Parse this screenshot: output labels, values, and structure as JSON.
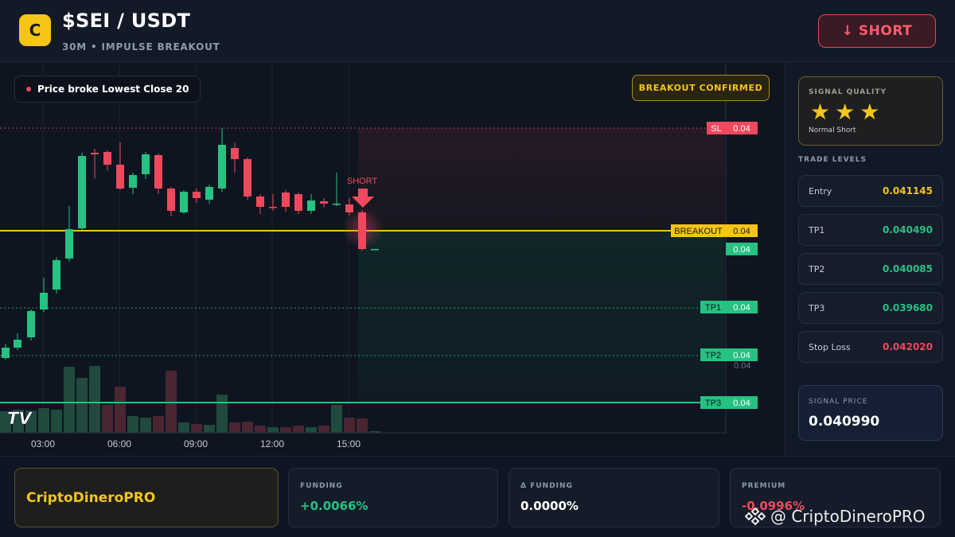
{
  "header": {
    "coin_letter": "C",
    "pair": "$SEI / USDT",
    "subtitle": "30M • IMPULSE BREAKOUT",
    "short_label": "↓ SHORT"
  },
  "chart": {
    "alert_text": "Price broke Lowest Close 20",
    "confirm_badge": "BREAKOUT CONFIRMED",
    "short_marker": "SHORT",
    "time_labels": [
      "03:00",
      "06:00",
      "09:00",
      "12:00",
      "15:00"
    ],
    "level_tags": {
      "sl": {
        "name": "SL",
        "value": "0.04"
      },
      "breakout": {
        "name": "BREAKOUT",
        "value": "0.04"
      },
      "current": {
        "value": "0.04"
      },
      "tp1": {
        "name": "TP1",
        "value": "0.04"
      },
      "tp2": {
        "name": "TP2",
        "value": "0.04"
      },
      "tp3": {
        "name": "TP3",
        "value": "0.04"
      },
      "tp2_scale": "0.04"
    },
    "colors": {
      "up": "#26c281",
      "down": "#f0495d",
      "breakout": "#f5c518"
    }
  },
  "sidebar": {
    "quality_label": "SIGNAL QUALITY",
    "stars": 3,
    "quality_text": "Normal Short",
    "levels_title": "TRADE LEVELS",
    "levels": [
      {
        "name": "Entry",
        "value": "0.041145",
        "color": "#f5c518"
      },
      {
        "name": "TP1",
        "value": "0.040490",
        "color": "#26c281"
      },
      {
        "name": "TP2",
        "value": "0.040085",
        "color": "#26c281"
      },
      {
        "name": "TP3",
        "value": "0.039680",
        "color": "#26c281"
      },
      {
        "name": "Stop Loss",
        "value": "0.042020",
        "color": "#f0495d"
      }
    ],
    "signal_price_label": "SIGNAL PRICE",
    "signal_price": "0.040990"
  },
  "footer": {
    "brand": "CriptoDineroPRO",
    "funding_label": "FUNDING",
    "funding_value": "+0.0066%",
    "dfunding_label": "Δ FUNDING",
    "dfunding_value": "0.0000%",
    "premium_label": "PREMIUM",
    "premium_value": "-0.0996%",
    "watermark": "@ CriptoDineroPRO"
  }
}
